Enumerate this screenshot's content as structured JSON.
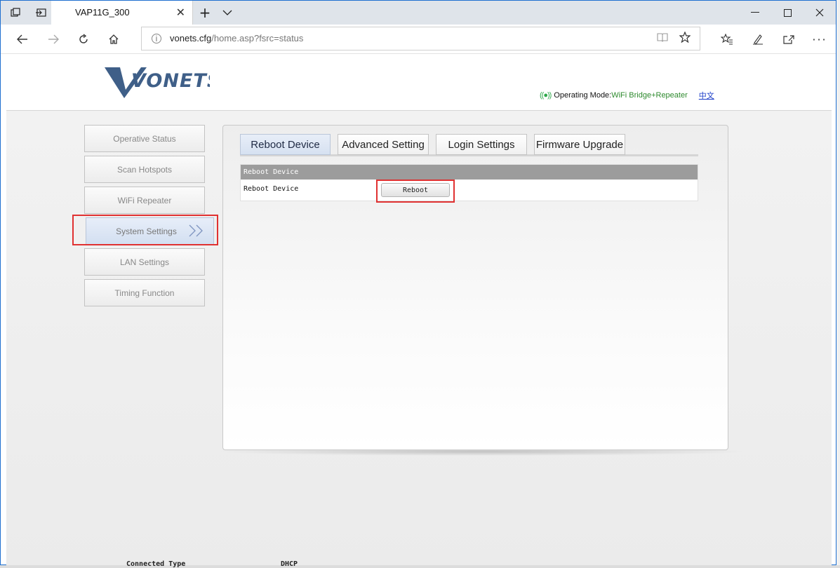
{
  "browser": {
    "tab_title": "VAP11G_300",
    "tab_close": "✕",
    "new_tab": "+",
    "tab_list": "⌄",
    "url_host": "vonets.cfg",
    "url_path": "/home.asp?fsrc=status",
    "info_icon": "i"
  },
  "header": {
    "logo_text": "VONETS",
    "op_mode_label": "Operating Mode:",
    "op_mode_value": "WiFi Bridge+Repeater",
    "language_link": "中文"
  },
  "sidebar": {
    "items": [
      {
        "label": "Operative Status"
      },
      {
        "label": "Scan Hotspots"
      },
      {
        "label": "WiFi Repeater"
      },
      {
        "label": "System Settings"
      },
      {
        "label": "LAN Settings"
      },
      {
        "label": "Timing Function"
      }
    ],
    "active_arrows": "»"
  },
  "tabs": [
    {
      "label": "Reboot Device"
    },
    {
      "label": "Advanced Setting"
    },
    {
      "label": "Login Settings"
    },
    {
      "label": "Firmware Upgrade"
    }
  ],
  "table": {
    "header": "Reboot Device",
    "row_label": "Reboot Device",
    "button_label": "Reboot"
  },
  "background_window": {
    "label": "Connected Type",
    "value": "DHCP"
  },
  "colors": {
    "highlight": "#e03131",
    "op_mode_value": "#2e8a2e",
    "link": "#1a3cc8"
  }
}
